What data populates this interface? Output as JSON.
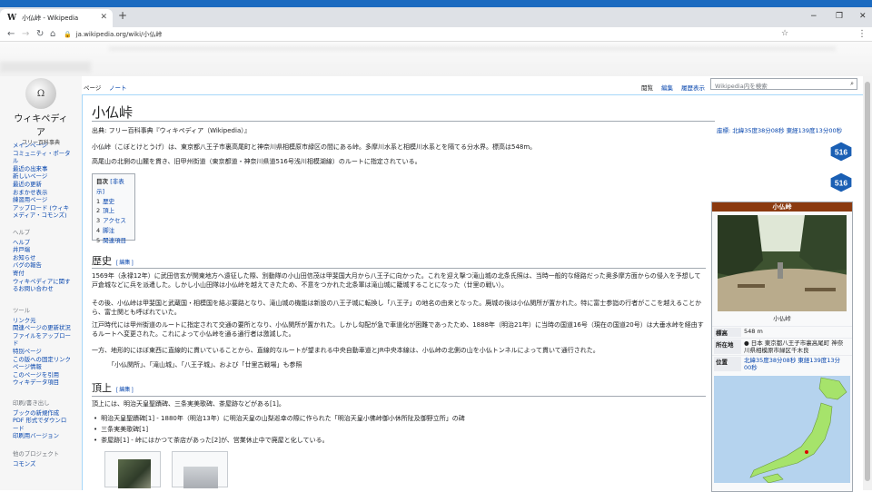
{
  "browser": {
    "tab_title": "小仏峠 - Wikipedia",
    "tab_icon": "W",
    "new_tab": "+",
    "url": "ja.wikipedia.org/wiki/小仏峠",
    "min": "−",
    "max": "❐",
    "close": "✕"
  },
  "sidebar": {
    "logo_title": "ウィキペディア",
    "logo_sub": "フリー百科事典",
    "nav": [
      "メインページ",
      "コミュニティ・ポータル",
      "最近の出来事",
      "新しいページ",
      "最近の更新",
      "おまかせ表示",
      "練習用ページ",
      "アップロード (ウィキメディア・コモンズ)"
    ],
    "help_heading": "ヘルプ",
    "help": [
      "ヘルプ",
      "井戸端",
      "お知らせ",
      "バグの報告",
      "寄付",
      "ウィキペディアに関するお問い合わせ"
    ],
    "tools_heading": "ツール",
    "tools": [
      "リンク元",
      "関連ページの更新状況",
      "ファイルをアップロード",
      "特別ページ",
      "この版への固定リンク",
      "ページ情報",
      "このページを引用",
      "ウィキデータ項目"
    ],
    "print_heading": "印刷/書き出し",
    "print": [
      "ブックの新規作成",
      "PDF 形式でダウンロード",
      "印刷用バージョン"
    ],
    "other_heading": "他のプロジェクト",
    "other": [
      "コモンズ"
    ]
  },
  "tabs": {
    "page": "ページ",
    "talk": "ノート",
    "read": "閲覧",
    "edit": "編集",
    "history": "履歴表示",
    "search_placeholder": "Wikipedia内を検索"
  },
  "article": {
    "title": "小仏峠",
    "from": "出典: フリー百科事典『ウィキペディア（Wikipedia）』",
    "coord": "座標: 北緯35度38分08秒 東経139度13分00秒",
    "lead1": "小仏峠（こぼとけとうげ）は、東京都八王子市裏高尾町と神奈川県相模原市緑区の間にある峠。多摩川水系と相模川水系とを隔てる分水界。標高は548m。",
    "lead2": "高尾山の北側の山麓を貫き、旧甲州街道（東京都道・神奈川県道516号浅川相模湖線）のルートに指定されている。",
    "toc_title": "目次",
    "toc_toggle": "[非表示]",
    "toc": [
      {
        "n": "1",
        "t": "歴史"
      },
      {
        "n": "2",
        "t": "頂上"
      },
      {
        "n": "3",
        "t": "アクセス"
      },
      {
        "n": "4",
        "t": "脚注"
      },
      {
        "n": "5",
        "t": "関連項目"
      }
    ],
    "edit_label": "[ 編集 ]",
    "h_history": "歴史",
    "hist1": "1569年（永禄12年）に武田信玄が関東地方へ遠征した際、別動隊の小山田信茂は甲斐国大月から八王子に向かった。これを迎え撃つ滝山城の北条氏照は、当時一般的な経路だった奥多摩方面からの侵入を予想して戸倉城などに兵を派遣した。しかし小山田隊は小仏峠を越えてきたため、不意をつかれた北条軍は滝山城に籠城することになった（廿里の戦い）。",
    "hist2": "その後、小仏峠は甲斐国と武蔵国・相模国を結ぶ要路となり、滝山城の機能は新設の八王子城に転換し「八王子」の地名の由来となった。廃城の後は小仏関所が置かれた。特に富士参詣の行者がここを越えることから、富士関とも呼ばれていた。",
    "hist3": "江戸時代には甲州街道のルートに指定されて交通の要所となり、小仏関所が置かれた。しかし勾配が急で車道化が困難であったため、1888年（明治21年）に当時の国道16号（現在の国道20号）は大垂水峠を経由するルートへ変更された。これによって小仏峠を通る通行者は激減した。",
    "hist4": "一方、地形的にほぼ東西に直線的に貫いていることから、直線的なルートが望まれる中央自動車道とJR中央本線は、小仏峠の北側の山を小仏トンネルによって貫いて通行された。",
    "hist_links": "「小仏関所」、「滝山城」、「八王子城」、および「廿里古戦場」も参照",
    "h_summit": "頂上",
    "summit_intro": "頂上には、明治天皇聖蹟碑、三条実美歌碑、茶屋跡などがある[1]。",
    "summit_items": [
      "明治天皇聖蹟碑[1] - 1880年（明治13年）に明治天皇の山梨巡幸の際に作られた「明治天皇小佛峠御小休所阯及御野立所」の碑",
      "三条実美歌碑[1]",
      "茶屋跡[1] - 峠にはかつて茶店があった[2]が、営業休止中で廃屋と化している。"
    ],
    "route_number": "516"
  },
  "infobox": {
    "title": "小仏峠",
    "caption": "小仏峠",
    "rows": [
      {
        "k": "標高",
        "v": "548 m"
      },
      {
        "k": "所在地",
        "v": "● 日本 東京都八王子市裏高尾町 神奈川県相模原市緑区千木良"
      },
      {
        "k": "位置",
        "v": "北緯35度38分08秒 東経139度13分00秒"
      }
    ]
  }
}
